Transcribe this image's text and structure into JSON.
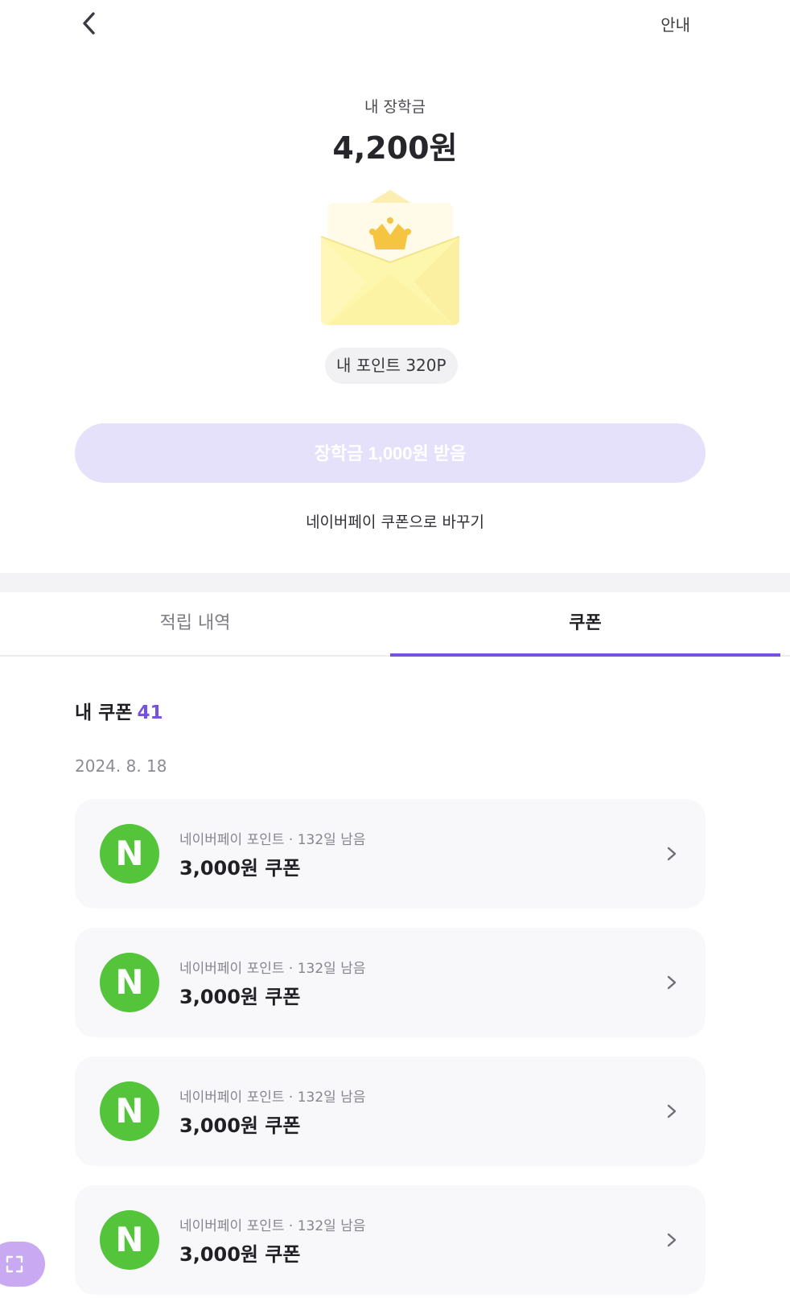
{
  "header": {
    "back_icon": "chevron-left-icon",
    "guide_label": "안내"
  },
  "summary": {
    "label": "내 장학금",
    "amount": "4,200원",
    "envelope_icon": "envelope-crown-icon"
  },
  "points": {
    "label": "내 포인트 320P"
  },
  "actions": {
    "claim_label": "장학금 1,000원 받음",
    "swap_label": "네이버페이 쿠폰으로 바꾸기"
  },
  "tabs": [
    {
      "label": "적립 내역",
      "active": false
    },
    {
      "label": "쿠폰",
      "active": true
    }
  ],
  "coupons": {
    "title": "내 쿠폰",
    "count": "41",
    "date": "2024. 8. 18",
    "items": [
      {
        "logo": "N",
        "meta": "네이버페이 포인트 · 132일 남음",
        "name": "3,000원 쿠폰"
      },
      {
        "logo": "N",
        "meta": "네이버페이 포인트 · 132일 남음",
        "name": "3,000원 쿠폰"
      },
      {
        "logo": "N",
        "meta": "네이버페이 포인트 · 132일 남음",
        "name": "3,000원 쿠폰"
      },
      {
        "logo": "N",
        "meta": "네이버페이 포인트 · 132일 남음",
        "name": "3,000원 쿠폰"
      }
    ]
  },
  "colors": {
    "accent": "#7553e0",
    "naver_green": "#54c43a",
    "disabled_button": "#e6e1fa",
    "fab": "#c9a9f2"
  },
  "fab": {
    "icon": "scan-frame-icon"
  }
}
